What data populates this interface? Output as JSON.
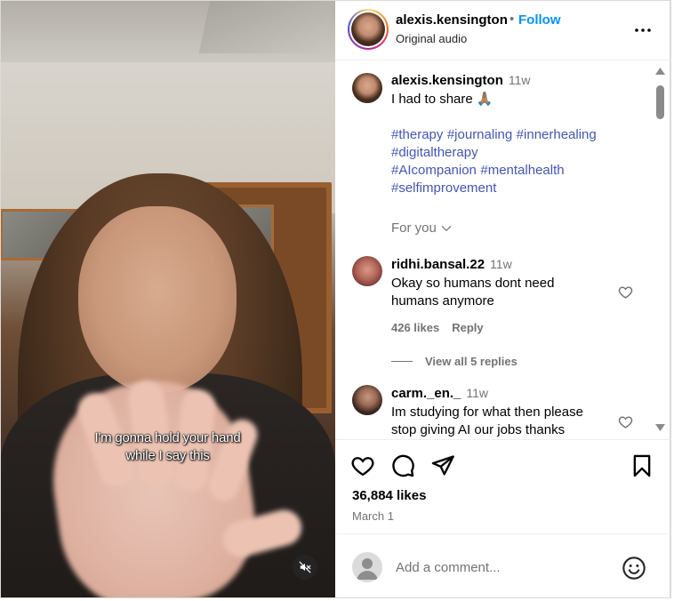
{
  "video": {
    "caption_line1": "I'm gonna hold your hand",
    "caption_line2": "while I say this",
    "mute_icon": "speaker-muted-icon"
  },
  "header": {
    "username": "alexis.kensington",
    "separator": "•",
    "follow_label": "Follow",
    "audio_label": "Original audio",
    "more_icon": "more-horizontal-icon"
  },
  "post": {
    "username": "alexis.kensington",
    "time": "11w",
    "text": "I had to share 🙏🏽",
    "hashtags_line1": [
      "#therapy",
      "#journaling",
      "#innerhealing"
    ],
    "hashtags_line2": [
      "#digitaltherapy"
    ],
    "hashtags_line3": [
      "#AIcompanion",
      "#mentalhealth"
    ],
    "hashtags_line4": [
      "#selfimprovement"
    ],
    "for_you_label": "For you"
  },
  "comments": [
    {
      "username": "ridhi.bansal.22",
      "time": "11w",
      "text_line1": "Okay so humans dont need",
      "text_line2": "humans anymore",
      "likes": "426 likes",
      "reply_label": "Reply",
      "view_replies": "View all 5 replies"
    },
    {
      "username": "carm._en._",
      "time": "11w",
      "text_line1": "Im studying for what then please",
      "text_line2": "stop giving AI our jobs thanks"
    }
  ],
  "actions": {
    "like_icon": "heart-icon",
    "comment_icon": "comment-icon",
    "share_icon": "share-icon",
    "save_icon": "bookmark-icon",
    "likes_count": "36,884 likes",
    "date": "March 1"
  },
  "comment_bar": {
    "placeholder": "Add a comment...",
    "emoji_icon": "emoji-icon"
  },
  "colors": {
    "follow_blue": "#0095f6",
    "hashtag_blue": "#4355b8",
    "muted_text": "#737373"
  }
}
